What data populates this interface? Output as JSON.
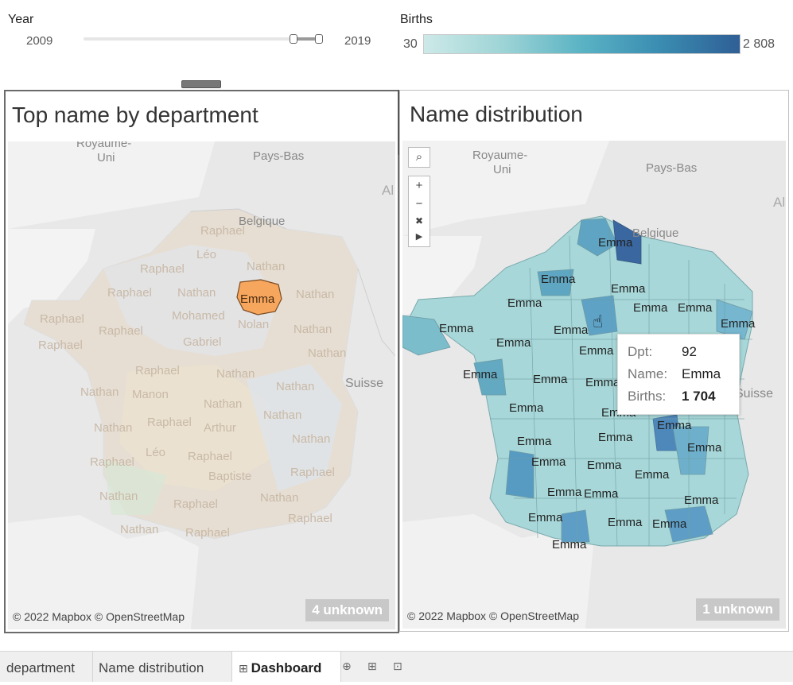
{
  "filters": {
    "year": {
      "label": "Year",
      "min": "2009",
      "max": "2019"
    },
    "births": {
      "label": "Births",
      "min": "30",
      "max": "2 808"
    }
  },
  "sheets": [
    {
      "title": "Top name by department",
      "attribution": "© 2022 Mapbox © OpenStreetMap",
      "unknown": "4 unknown",
      "map_places": [
        "Royaume-",
        "Uni",
        "Pays-Bas",
        "Belgique",
        "Al",
        "Suisse"
      ],
      "region_labels": [
        "Raphael",
        "Léo",
        "Nathan",
        "Raphael",
        "Raphael",
        "Nathan",
        "Emma",
        "Nathan",
        "Raphael",
        "Mohamed",
        "Nolan",
        "Raphael",
        "Gabriel",
        "Nathan",
        "Raphael",
        "Nathan",
        "Nathan",
        "Raphael",
        "Nathan",
        "Nathan",
        "Manon",
        "Nathan",
        "Nathan",
        "Nathan",
        "Raphael",
        "Arthur",
        "Nathan",
        "Raphael",
        "Léo",
        "Raphael",
        "Baptiste",
        "Raphael",
        "Nathan",
        "Raphael",
        "Nathan",
        "Raphael",
        "Nathan",
        "Raphael"
      ]
    },
    {
      "title": "Name distribution",
      "attribution": "© 2022 Mapbox © OpenStreetMap",
      "unknown": "1 unknown",
      "map_places": [
        "Royaume-",
        "Uni",
        "Pays-Bas",
        "Belgique",
        "Al",
        "Suisse"
      ],
      "region_label": "Emma"
    }
  ],
  "tooltip": {
    "rows": [
      {
        "key": "Dpt:",
        "value": "92"
      },
      {
        "key": "Name:",
        "value": "Emma"
      },
      {
        "key": "Births:",
        "value": "1 704"
      }
    ]
  },
  "map_controls": [
    "search-icon",
    "plus-icon",
    "minus-icon",
    "pin-icon",
    "play-icon"
  ],
  "toolbar_icons": [
    "close-icon",
    "external-link-icon",
    "filter-icon",
    "more-icon"
  ],
  "tabs": [
    {
      "label": "department"
    },
    {
      "label": "Name distribution"
    },
    {
      "label": "Dashboard",
      "active": true
    }
  ],
  "colors": {
    "highlight_orange": "#f7a65d",
    "choropleth_light": "#cde9e8",
    "choropleth_dark": "#2f5f96"
  }
}
